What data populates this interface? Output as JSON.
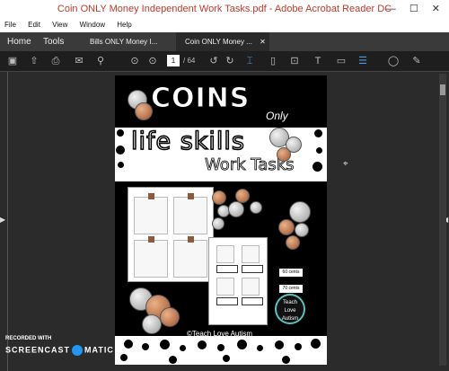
{
  "window": {
    "title": "Coin ONLY Money Independent Work Tasks.pdf - Adobe Acrobat Reader DC"
  },
  "menu": [
    "File",
    "Edit",
    "View",
    "Window",
    "Help"
  ],
  "tabs": {
    "home": "Home",
    "tools": "Tools",
    "doc1": "Bills ONLY Money I...",
    "doc2": "Coin ONLY Money ..."
  },
  "toolbar": {
    "page_current": "1",
    "page_total": "/ 64"
  },
  "document": {
    "title_line1": "COINS",
    "title_only": "Only",
    "title_line2": "life skills",
    "title_line3": "Work Tasks",
    "label_60": "60 cents",
    "label_70": "70 cents",
    "badge": "Teach Love Autism",
    "credit": "©Teach Love Autism"
  },
  "watermark": {
    "recorded": "RECORDED WITH",
    "brand_left": "SCREENCAST",
    "brand_right": "MATIC"
  },
  "colors": {
    "title_red": "#c0392b",
    "accent_blue": "#4a9be8"
  }
}
